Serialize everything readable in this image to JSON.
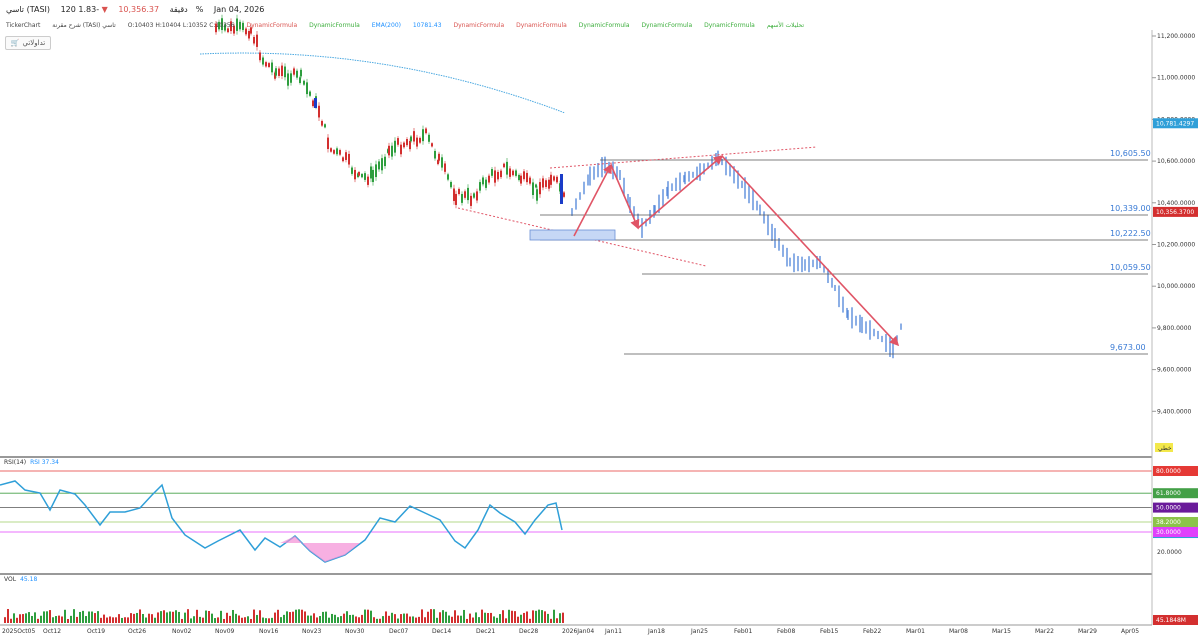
{
  "header": {
    "title": "تاسي (TASI)",
    "interval": "120 دقيقة",
    "price": "10,356.37",
    "change": "-1.83%",
    "date": "Jan 04, 2026",
    "ohlc": "O:10403  H:10404  L:10352  C:10356",
    "change_color": "#d9534f"
  },
  "studies": {
    "ticker": "TickerChart",
    "title_ar": "شرح مقرنة (TASI) تاسي",
    "items": [
      "DynamicFormula",
      "DynamicFormula",
      "EMA(200)",
      "10781.43",
      "DynamicFormula",
      "DynamicFormula",
      "DynamicFormula",
      "DynamicFormula",
      "DynamicFormula",
      "تحليلات الأسهم"
    ]
  },
  "logo": "تداولاتي",
  "price_axis": [
    "11,200.0000",
    "11,000.0000",
    "10,800.0000",
    "10,600.0000",
    "10,400.0000",
    "10,200.0000",
    "10,000.0000",
    "9,800.0000",
    "9,600.0000",
    "9,400.0000"
  ],
  "axis_badges": {
    "ema": "10,781.4297",
    "last": "10,356.3700",
    "chart_type": "خطي"
  },
  "levels": [
    "10,605.50",
    "10,339.00",
    "10,222.50",
    "10,059.50",
    "9,673.00"
  ],
  "rsi": {
    "label": "RSI(14)",
    "value_label": "RSI 37.34",
    "levels": [
      "80.0000",
      "61.8000",
      "50.0000",
      "38.2000",
      "37.3448",
      "30.0000",
      "20.0000"
    ]
  },
  "volume": {
    "label": "VOL",
    "value_label": "45.18",
    "badge": "45.1848M"
  },
  "time_axis": [
    "2025Oct05",
    "Oct12",
    "Oct19",
    "Oct26",
    "Nov02",
    "Nov09",
    "Nov16",
    "Nov23",
    "Nov30",
    "Dec07",
    "Dec14",
    "Dec21",
    "Dec28",
    "2026Jan04",
    "Jan11",
    "Jan18",
    "Jan25",
    "Feb01",
    "Feb08",
    "Feb15",
    "Feb22",
    "Mar01",
    "Mar08",
    "Mar15",
    "Mar22",
    "Mar29",
    "Apr05"
  ],
  "colors": {
    "up": "#2e9e3e",
    "down": "#d32f2f",
    "forecast": "#5b8ddb",
    "ema": "#4aa8e0",
    "rsi": "#2f9fd8",
    "arrow": "#e05566"
  }
}
